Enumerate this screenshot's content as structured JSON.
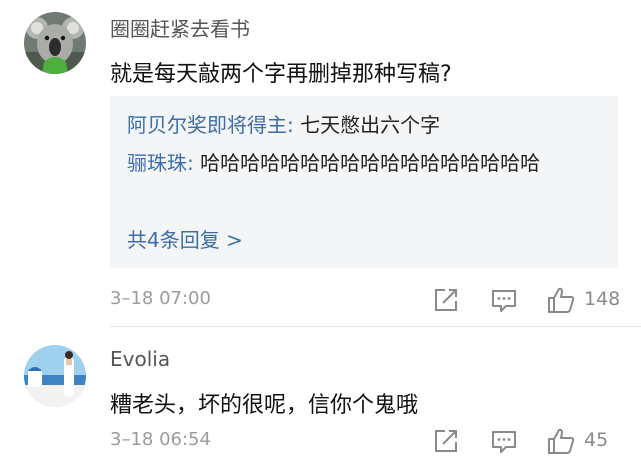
{
  "comments": [
    {
      "username": "圈圈赶紧去看书",
      "text": "就是每天敲两个字再删掉那种写稿?",
      "replies": [
        {
          "author": "阿贝尔奖即将得主:",
          "text": " 七天憋出六个字"
        },
        {
          "author": "骊珠珠:",
          "text": " 哈哈哈哈哈哈哈哈哈哈哈哈哈哈哈哈哈"
        }
      ],
      "more_replies": "共4条回复 >",
      "timestamp": "3–18 07:00",
      "likes": "148",
      "avatar_icon": "koala-avatar"
    },
    {
      "username": "Evolia",
      "text": "糟老头，坏的很呢，信你个鬼哦",
      "timestamp": "3–18 06:54",
      "likes": "45",
      "avatar_icon": "seaside-avatar"
    }
  ],
  "icons": {
    "share": "share-icon",
    "comment": "comment-icon",
    "like": "thumbs-up-icon"
  },
  "colors": {
    "link": "#3d6da8",
    "reply_background": "#f4f5f7",
    "meta_text": "#9b9b9b"
  }
}
